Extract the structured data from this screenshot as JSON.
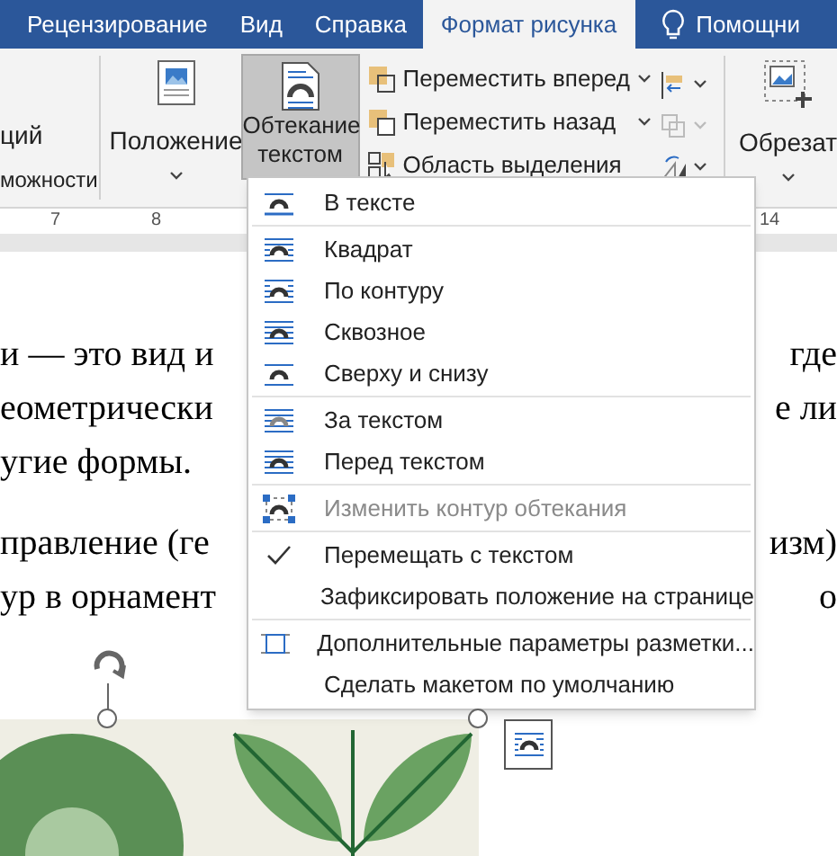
{
  "tabs": [
    {
      "label": "Рецензирование",
      "selected": false
    },
    {
      "label": "Вид",
      "selected": false
    },
    {
      "label": "Справка",
      "selected": false
    },
    {
      "label": "Формат рисунка",
      "selected": true
    }
  ],
  "assistant": {
    "label": "Помощни"
  },
  "ribbon": {
    "left_group": {
      "button_label": "ций",
      "group_label": "можности"
    },
    "position_button": {
      "label": "Положение"
    },
    "wrap_button": {
      "label": "Обтекание текстом",
      "pressed": true
    },
    "arrange_items": [
      {
        "kind": "forward",
        "label": "Переместить вперед"
      },
      {
        "kind": "backward",
        "label": "Переместить назад"
      },
      {
        "kind": "selection",
        "label": "Область выделения"
      }
    ],
    "crop_button": {
      "label": "Обрезат"
    }
  },
  "ruler": {
    "numbers": [
      "7",
      "8",
      "14"
    ]
  },
  "document": {
    "lines": [
      {
        "left": "и — это вид и",
        "right": "где"
      },
      {
        "left": "еометрически",
        "right": "е ли"
      },
      {
        "left": "угие формы."
      },
      {
        "left": "правление (ге",
        "right": "изм)"
      },
      {
        "left": "ур в орнамент",
        "right": "о"
      }
    ]
  },
  "wrap_menu": {
    "sections": [
      [
        {
          "kind": "inline",
          "label": "В тексте",
          "checked": false,
          "disabled": false
        }
      ],
      [
        {
          "kind": "square",
          "label": "Квадрат",
          "checked": false,
          "disabled": false
        },
        {
          "kind": "tight",
          "label": "По контуру",
          "checked": false,
          "disabled": false
        },
        {
          "kind": "through",
          "label": "Сквозное",
          "checked": false,
          "disabled": false
        },
        {
          "kind": "topbottom",
          "label": "Сверху и снизу",
          "checked": false,
          "disabled": false
        }
      ],
      [
        {
          "kind": "behind",
          "label": "За текстом",
          "checked": false,
          "disabled": false
        },
        {
          "kind": "front",
          "label": "Перед текстом",
          "checked": false,
          "disabled": false
        }
      ],
      [
        {
          "kind": "points",
          "label": "Изменить контур обтекания",
          "checked": false,
          "disabled": true
        }
      ],
      [
        {
          "kind": "plain",
          "label": "Перемещать с текстом",
          "checked": true,
          "disabled": false
        },
        {
          "kind": "plain",
          "label": "Зафиксировать положение на странице",
          "checked": false,
          "disabled": false
        }
      ],
      [
        {
          "kind": "layout",
          "label": "Дополнительные параметры разметки...",
          "checked": false,
          "disabled": false
        },
        {
          "kind": "plain",
          "label": "Сделать макетом по умолчанию",
          "checked": false,
          "disabled": false
        }
      ]
    ]
  }
}
